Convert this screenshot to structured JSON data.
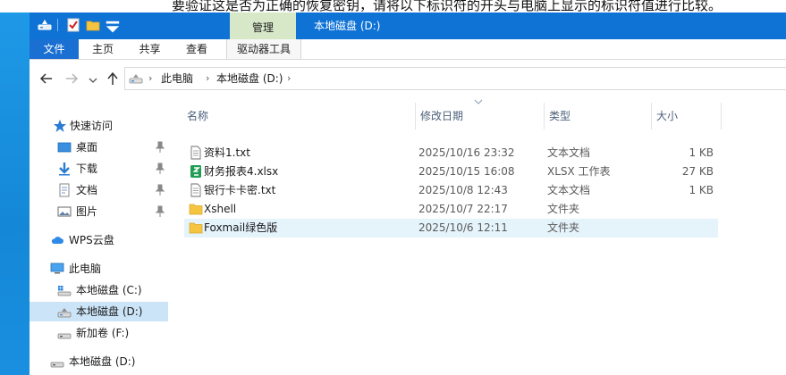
{
  "background": {
    "top_text": "要验证这是否为正确的恢复密钥，请将以下标识符的开头与电脑上显示的标识符值进行比较。"
  },
  "titlebar": {
    "manage_tab": "管理",
    "title": "本地磁盘 (D:)",
    "accent": "#0f73d6"
  },
  "ribbon": {
    "tabs": {
      "file": "文件",
      "home": "主页",
      "share": "共享",
      "view": "查看",
      "drive_tools": "驱动器工具"
    }
  },
  "address": {
    "crumbs": [
      "此电脑",
      "本地磁盘 (D:)"
    ]
  },
  "nav": {
    "quick_access": "快速访问",
    "desktop": "桌面",
    "downloads": "下载",
    "documents": "文档",
    "pictures": "图片",
    "wps_cloud": "WPS云盘",
    "this_pc": "此电脑",
    "drive_c": "本地磁盘 (C:)",
    "drive_d": "本地磁盘 (D:)",
    "drive_f": "新加卷 (F:)",
    "drive_d2": "本地磁盘 (D:)"
  },
  "columns": {
    "name": "名称",
    "date": "修改日期",
    "type": "类型",
    "size": "大小"
  },
  "files": [
    {
      "name": "资料1.txt",
      "date": "2025/10/16 23:32",
      "type": "文本文档",
      "size": "1 KB",
      "icon": "text-file-icon"
    },
    {
      "name": "财务报表4.xlsx",
      "date": "2025/10/15 16:08",
      "type": "XLSX 工作表",
      "size": "27 KB",
      "icon": "spreadsheet-file-icon"
    },
    {
      "name": "银行卡卡密.txt",
      "date": "2025/10/8 12:43",
      "type": "文本文档",
      "size": "1 KB",
      "icon": "text-file-icon"
    },
    {
      "name": "Xshell",
      "date": "2025/10/7 22:17",
      "type": "文件夹",
      "size": "",
      "icon": "folder-icon"
    },
    {
      "name": "Foxmail绿色版",
      "date": "2025/10/6 12:11",
      "type": "文件夹",
      "size": "",
      "icon": "folder-icon"
    }
  ]
}
